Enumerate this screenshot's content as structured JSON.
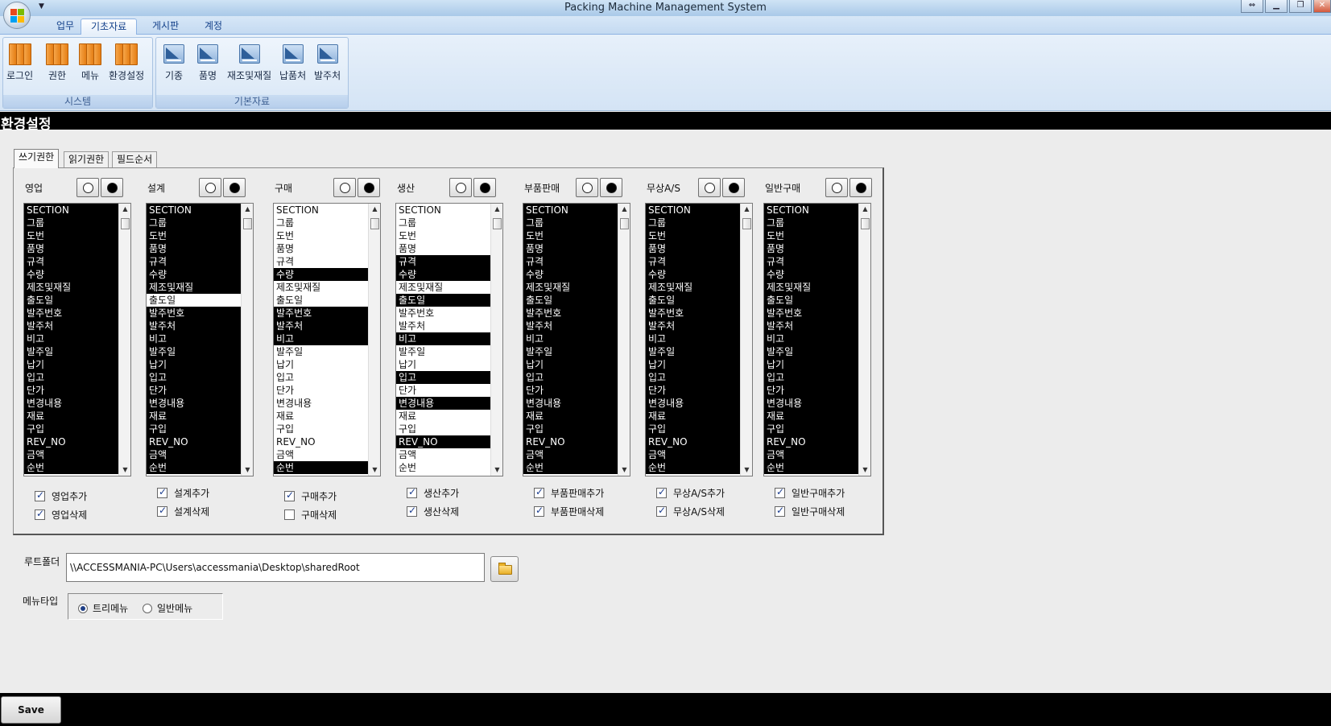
{
  "window": {
    "title": "Packing Machine Management System",
    "qat_icon": "chevron-down-icon"
  },
  "ribbon": {
    "tabs": [
      "업무",
      "기초자료",
      "게시판",
      "계정"
    ],
    "groups": [
      {
        "label": "시스템",
        "buttons": [
          "로그인",
          "권한",
          "메뉴",
          "환경설정"
        ]
      },
      {
        "label": "기본자료",
        "buttons": [
          "기종",
          "품명",
          "재조및재질",
          "납품처",
          "발주처"
        ]
      }
    ]
  },
  "section_title": "환경설정",
  "page_tabs": [
    "쓰기권한",
    "읽기권한",
    "필드순서"
  ],
  "fields": [
    "SECTION",
    "그룹",
    "도번",
    "품명",
    "규격",
    "수량",
    "제조및재질",
    "출도일",
    "발주번호",
    "발주처",
    "비고",
    "발주일",
    "납기",
    "입고",
    "단가",
    "변경내용",
    "재료",
    "구입",
    "REV_NO",
    "금액",
    "순번"
  ],
  "columns": [
    {
      "label": "영업",
      "selected": [
        0,
        1,
        2,
        3,
        4,
        5,
        6,
        7,
        8,
        9,
        10,
        11,
        12,
        13,
        14,
        15,
        16,
        17,
        18,
        19,
        20
      ],
      "add_label": "영업추가",
      "add_checked": true,
      "del_label": "영업삭제",
      "del_checked": true
    },
    {
      "label": "설계",
      "selected": [
        0,
        1,
        2,
        3,
        4,
        5,
        6,
        8,
        9,
        10,
        11,
        12,
        13,
        14,
        15,
        16,
        17,
        18,
        19,
        20
      ],
      "add_label": "설계추가",
      "add_checked": true,
      "del_label": "설계삭제",
      "del_checked": true
    },
    {
      "label": "구매",
      "selected": [
        5,
        8,
        9,
        10,
        20
      ],
      "add_label": "구매추가",
      "add_checked": true,
      "del_label": "구매삭제",
      "del_checked": false
    },
    {
      "label": "생산",
      "selected": [
        4,
        5,
        7,
        10,
        13,
        15,
        18
      ],
      "add_label": "생산추가",
      "add_checked": true,
      "del_label": "생산삭제",
      "del_checked": true
    },
    {
      "label": "부품판매",
      "selected": [
        0,
        1,
        2,
        3,
        4,
        5,
        6,
        7,
        8,
        9,
        10,
        11,
        12,
        13,
        14,
        15,
        16,
        17,
        18,
        19,
        20
      ],
      "add_label": "부품판매추가",
      "add_checked": true,
      "del_label": "부품판매삭제",
      "del_checked": true
    },
    {
      "label": "무상A/S",
      "selected": [
        0,
        1,
        2,
        3,
        4,
        5,
        6,
        7,
        8,
        9,
        10,
        11,
        12,
        13,
        14,
        15,
        16,
        17,
        18,
        19,
        20
      ],
      "add_label": "무상A/S추가",
      "add_checked": true,
      "del_label": "무상A/S삭제",
      "del_checked": true
    },
    {
      "label": "일반구매",
      "selected": [
        0,
        1,
        2,
        3,
        4,
        5,
        6,
        7,
        8,
        9,
        10,
        11,
        12,
        13,
        14,
        15,
        16,
        17,
        18,
        19,
        20
      ],
      "add_label": "일반구매추가",
      "add_checked": true,
      "del_label": "일반구매삭제",
      "del_checked": true
    }
  ],
  "root_folder": {
    "label": "루트폴더",
    "value": "\\\\ACCESSMANIA-PC\\Users\\accessmania\\Desktop\\sharedRoot",
    "button_icon": "folder-open-icon"
  },
  "menu_type": {
    "label": "메뉴타입",
    "options": [
      "트리메뉴",
      "일반메뉴"
    ],
    "selected": 0
  },
  "save_label": "Save"
}
